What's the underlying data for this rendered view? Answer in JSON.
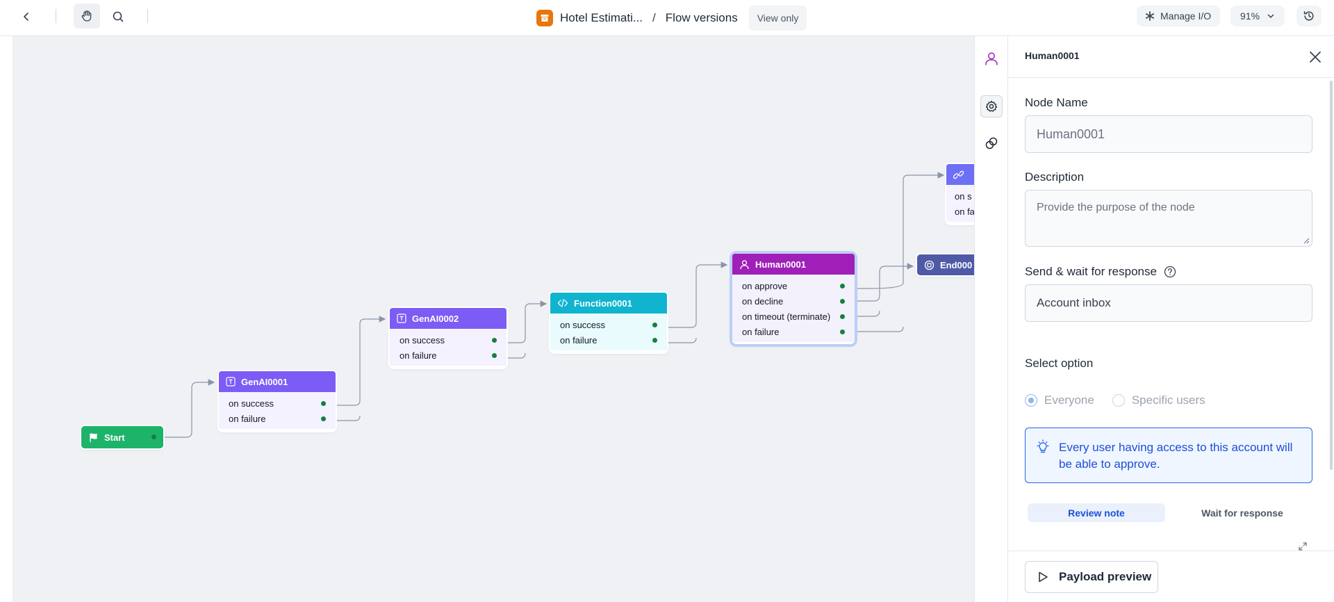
{
  "topbar": {
    "app_name": "Hotel Estimati...",
    "separator": "/",
    "page": "Flow versions",
    "mode_badge": "View only",
    "manage_io": "Manage I/O",
    "zoom": "91%"
  },
  "nodes": {
    "start": {
      "title": "Start"
    },
    "genai1": {
      "title": "GenAI0001",
      "ports": [
        "on success",
        "on failure"
      ]
    },
    "genai2": {
      "title": "GenAI0002",
      "ports": [
        "on success",
        "on failure"
      ]
    },
    "function1": {
      "title": "Function0001",
      "ports": [
        "on success",
        "on failure"
      ]
    },
    "human1": {
      "title": "Human0001",
      "ports": [
        "on approve",
        "on decline",
        "on timeout (terminate)",
        "on failure"
      ]
    },
    "link_node": {
      "ports": [
        "on s",
        "on fa"
      ]
    },
    "end_node": {
      "title": "End000"
    }
  },
  "panel": {
    "title": "Human0001",
    "node_name_label": "Node Name",
    "node_name_value": "Human0001",
    "description_label": "Description",
    "description_placeholder": "Provide the purpose of the node",
    "send_wait_label": "Send & wait for response",
    "send_wait_value": "Account inbox",
    "select_option_label": "Select option",
    "options": [
      "Everyone",
      "Specific users"
    ],
    "selected_option": "Everyone",
    "info_text": "Every user having access to this account will be able to approve.",
    "tabs": [
      "Review note",
      "Wait for response"
    ],
    "active_tab": "Review note",
    "payload_button": "Payload preview"
  },
  "colors": {
    "start": "#1db46a",
    "genai": "#7c5cf5",
    "function": "#10b4cf",
    "human": "#a01fb8",
    "link": "#6d6ff5",
    "end": "#4f5aa6",
    "edge": "#8b95a7",
    "port_dot": "#15803d",
    "accent": "#2563eb"
  }
}
